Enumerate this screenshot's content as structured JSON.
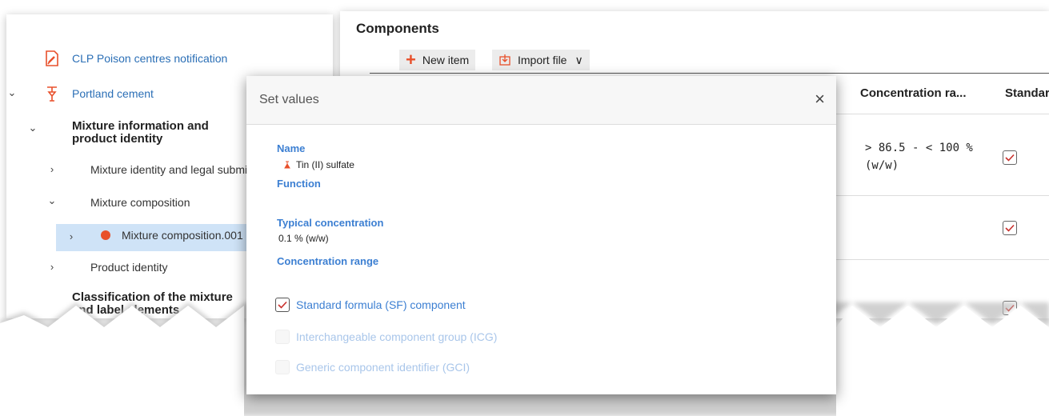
{
  "tree": {
    "items": [
      {
        "label": "CLP Poison centres notification",
        "icon": "notification-doc-icon"
      },
      {
        "label": "Portland cement",
        "icon": "mixture-flask-icon"
      },
      {
        "label": "Mixture information and product identity"
      },
      {
        "label": "Mixture identity and legal submitter"
      },
      {
        "label": "Mixture composition"
      },
      {
        "label": "Mixture composition.001"
      },
      {
        "label": "Product identity"
      },
      {
        "label": "Classification of the mixture and label elements"
      }
    ]
  },
  "components": {
    "title": "Components",
    "new_item_label": "New item",
    "import_file_label": "Import file",
    "columns": [
      "Concentration ra...",
      "Standar"
    ],
    "rows": [
      {
        "concentration": "> 86.5 - < 100 % (w/w)",
        "standard": true
      },
      {
        "concentration": "",
        "standard": true
      },
      {
        "concentration": "",
        "standard": true
      }
    ]
  },
  "dialog": {
    "title": "Set values",
    "close_glyph": "×",
    "fields": {
      "name_label": "Name",
      "name_value": "Tin (II) sulfate",
      "function_label": "Function",
      "typical_label": "Typical concentration",
      "typical_value": "0.1  % (w/w)",
      "range_label": "Concentration range"
    },
    "checkboxes": [
      {
        "label": "Standard formula (SF) component",
        "checked": true,
        "enabled": true
      },
      {
        "label": "Interchangeable component group (ICG)",
        "checked": false,
        "enabled": false
      },
      {
        "label": "Generic component identifier (GCI)",
        "checked": false,
        "enabled": false
      }
    ]
  },
  "colors": {
    "accent": "#3c7fd2",
    "link": "#2b6fb6",
    "selected": "#cfe3f7",
    "brand_orange": "#e8502b"
  }
}
